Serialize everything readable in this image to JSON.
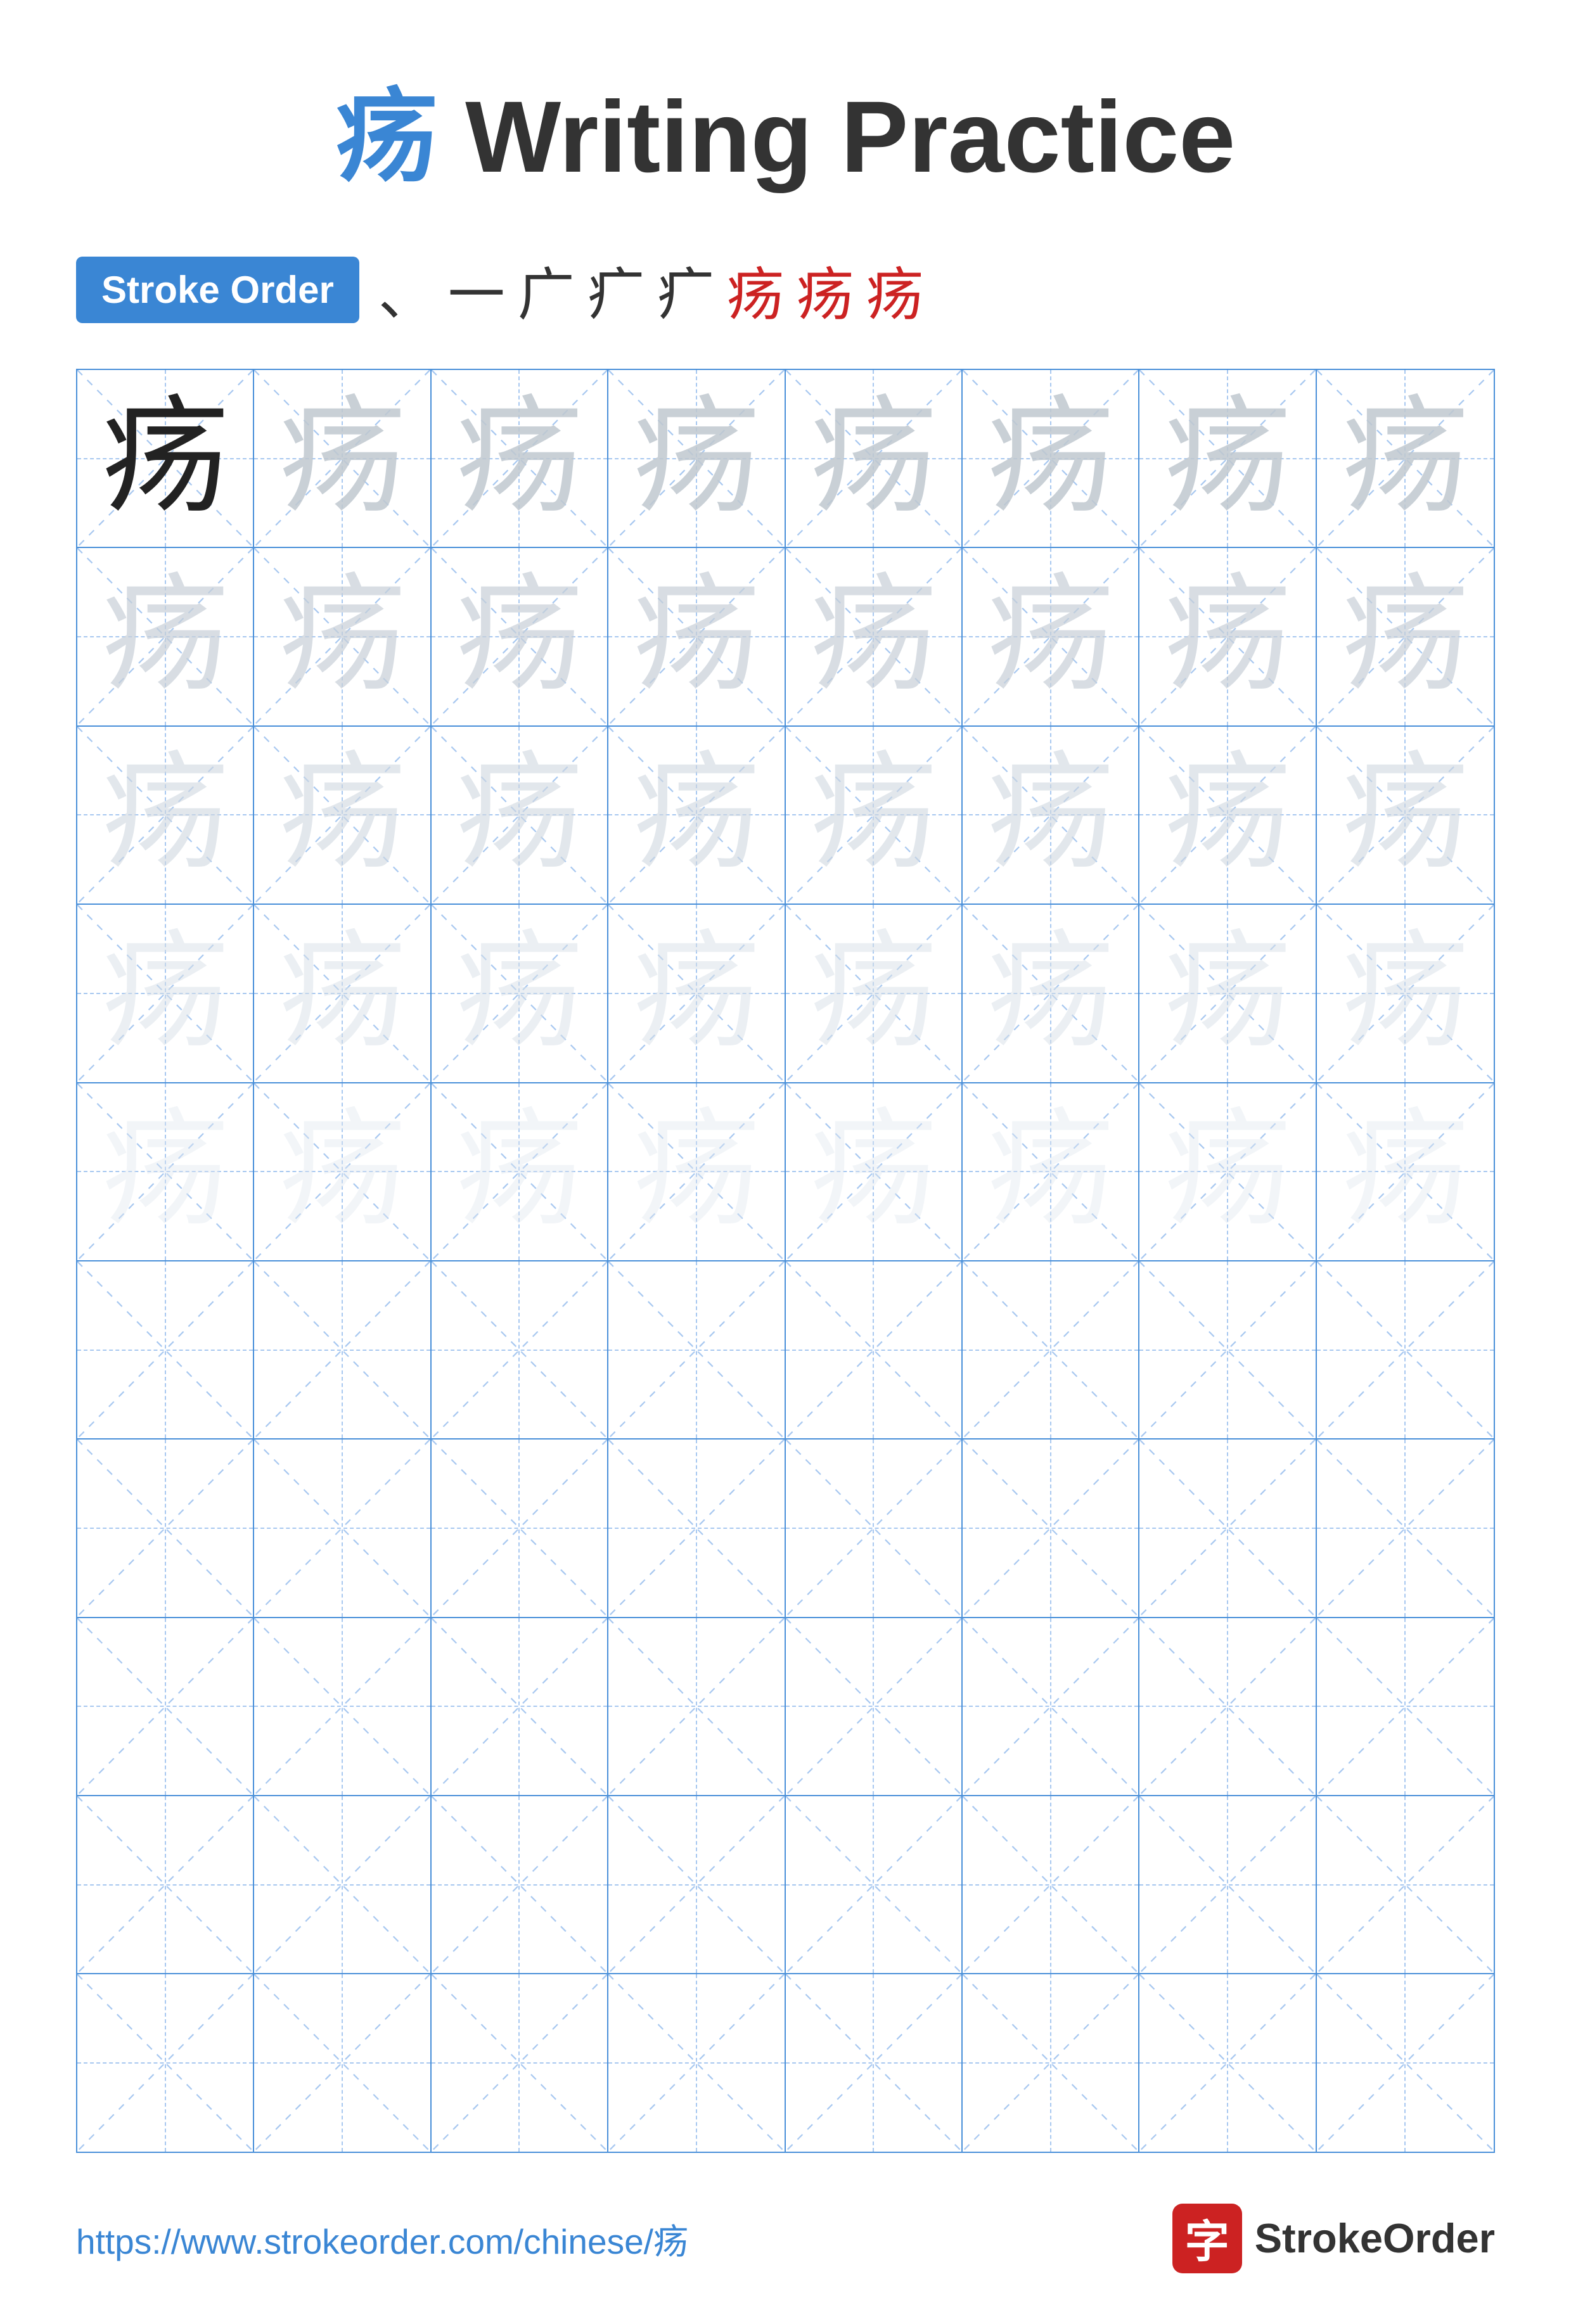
{
  "title": {
    "char": "疡",
    "text": " Writing Practice"
  },
  "stroke_order": {
    "badge_label": "Stroke Order",
    "sequence": [
      "、",
      "一",
      "广",
      "疒",
      "疒",
      "疡",
      "疡",
      "疡"
    ]
  },
  "grid": {
    "rows": 10,
    "cols": 8,
    "char": "疡",
    "filled_rows": 5,
    "char_styles": [
      "dark",
      "light-1",
      "light-2",
      "light-3",
      "light-4",
      "light-5"
    ]
  },
  "footer": {
    "url": "https://www.strokeorder.com/chinese/疡",
    "logo_char": "字",
    "logo_name": "StrokeOrder"
  }
}
